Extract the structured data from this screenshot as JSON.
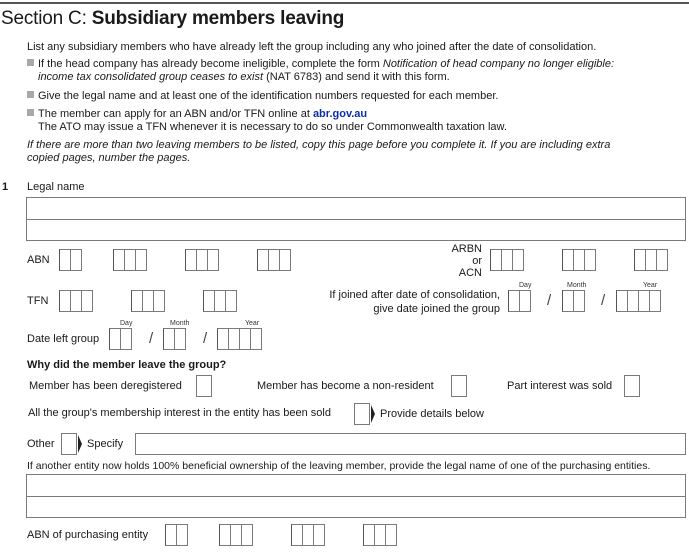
{
  "section": {
    "prefix": "Section C: ",
    "title": "Subsidiary members leaving"
  },
  "intro": {
    "line1": "List any subsidiary members who have already left the group including any who joined after the date of consolidation.",
    "bullet1_pre": "If the head company has already become ineligible, complete the form ",
    "bullet1_italic": "Notification of head company no longer eligible:",
    "bullet1_italic2": "income tax consolidated group ceases to exist",
    "bullet1_post": " (NAT 6783) and send it with this form.",
    "bullet2": "Give the legal name and at least one of the identification numbers requested for each member.",
    "bullet3_pre": "The member can apply for an ABN and/or TFN online at ",
    "bullet3_link": "abr.gov.au",
    "bullet3_line2": "The ATO may issue a TFN whenever it is necessary to do so under Commonwealth taxation law.",
    "note_line1": "If there are more than two leaving members to be listed, copy this page before you complete it. If you are including extra",
    "note_line2": "copied pages, number the pages."
  },
  "member": {
    "number": "1",
    "legal_name_label": "Legal name",
    "abn_label": "ABN",
    "arbn_label_1": "ARBN",
    "arbn_label_2": "or",
    "arbn_label_3": "ACN",
    "tfn_label": "TFN",
    "joined_label_1": "If joined after date of consolidation,",
    "joined_label_2": "give date joined the group",
    "date_left_label": "Date left group",
    "day_label": "Day",
    "month_label": "Month",
    "year_label": "Year",
    "slash": "/",
    "why_heading": "Why did the member leave the group?",
    "reasons": {
      "deregistered": "Member has been deregistered",
      "non_resident": "Member has become a non-resident",
      "part_sold": "Part interest was sold",
      "all_sold": "All the group's membership interest in the entity has been sold",
      "provide_details": "Provide details below",
      "other": "Other",
      "specify": "Specify"
    },
    "purchaser_note": "If another entity now holds 100% beneficial ownership of the leaving member, provide the legal name of one of the purchasing entities.",
    "abn_purchasing_label": "ABN of purchasing entity"
  },
  "colors": {
    "link": "#0b2fa8",
    "box_border": "#7a7a7a",
    "bullet": "#a8a8a8"
  }
}
